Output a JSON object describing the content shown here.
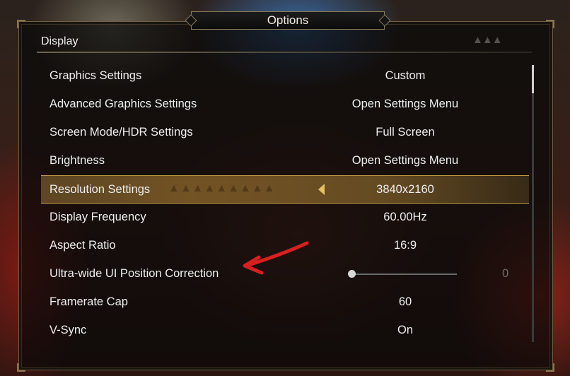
{
  "dialog": {
    "title": "Options"
  },
  "section": {
    "title": "Display"
  },
  "settings": [
    {
      "label": "Graphics Settings",
      "value": "Custom"
    },
    {
      "label": "Advanced Graphics Settings",
      "value": "Open Settings Menu"
    },
    {
      "label": "Screen Mode/HDR Settings",
      "value": "Full Screen"
    },
    {
      "label": "Brightness",
      "value": "Open Settings Menu"
    },
    {
      "label": "Resolution Settings",
      "value": "3840x2160",
      "selected": true
    },
    {
      "label": "Display Frequency",
      "value": "60.00Hz"
    },
    {
      "label": "Aspect Ratio",
      "value": "16:9"
    },
    {
      "label": "Ultra-wide UI Position Correction",
      "value": "0",
      "slider_level": 0
    },
    {
      "label": "Framerate Cap",
      "value": "60"
    },
    {
      "label": "V-Sync",
      "value": "On"
    }
  ],
  "colors": {
    "highlight": "#c8a04a",
    "annotation": "#d91f1f",
    "text": "#eeeeee"
  }
}
